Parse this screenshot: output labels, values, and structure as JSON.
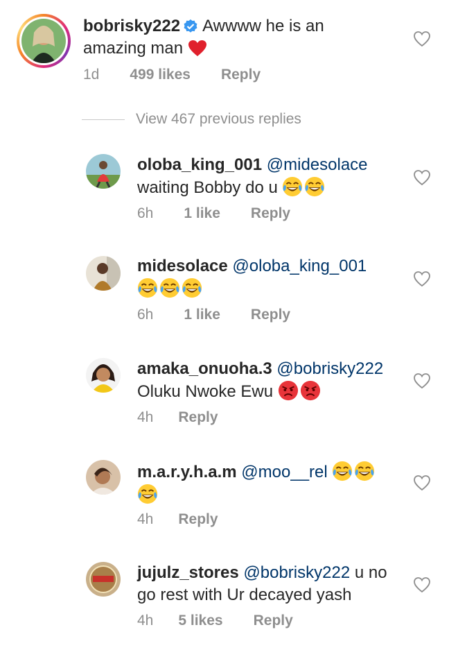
{
  "main_comment": {
    "username": "bobrisky222",
    "text_line1": "Awwww he is an",
    "text_line2": "amazing man",
    "time": "1d",
    "likes": "499 likes",
    "reply": "Reply"
  },
  "view_replies": "View 467 previous replies",
  "replies": [
    {
      "username": "oloba_king_001",
      "mention": "@midesolace",
      "text": "waiting Bobby do u",
      "time": "6h",
      "likes": "1 like",
      "reply": "Reply"
    },
    {
      "username": "midesolace",
      "mention": "@oloba_king_001",
      "text": "",
      "time": "6h",
      "likes": "1 like",
      "reply": "Reply"
    },
    {
      "username": "amaka_onuoha.3",
      "mention": "@bobrisky222",
      "text": "Oluku Nwoke Ewu",
      "time": "4h",
      "likes": "",
      "reply": "Reply"
    },
    {
      "username": "m.a.r.y.h.a.m",
      "mention": "@moo__rel",
      "text": "",
      "time": "4h",
      "likes": "",
      "reply": "Reply"
    },
    {
      "username": "jujulz_stores",
      "mention": "@bobrisky222",
      "text_line1": "u no",
      "text_line2": "go rest with Ur decayed yash",
      "time": "4h",
      "likes": "5 likes",
      "reply": "Reply"
    }
  ],
  "icons": {
    "like": "heart-outline-icon",
    "verified": "verified-badge-icon",
    "emoji_laugh": "tears-of-joy-emoji",
    "emoji_angry": "angry-face-emoji",
    "heart_emoji": "red-heart-emoji"
  },
  "colors": {
    "mention": "#003569",
    "meta": "#8e8e8e",
    "verified": "#3897f0",
    "text": "#262626"
  }
}
